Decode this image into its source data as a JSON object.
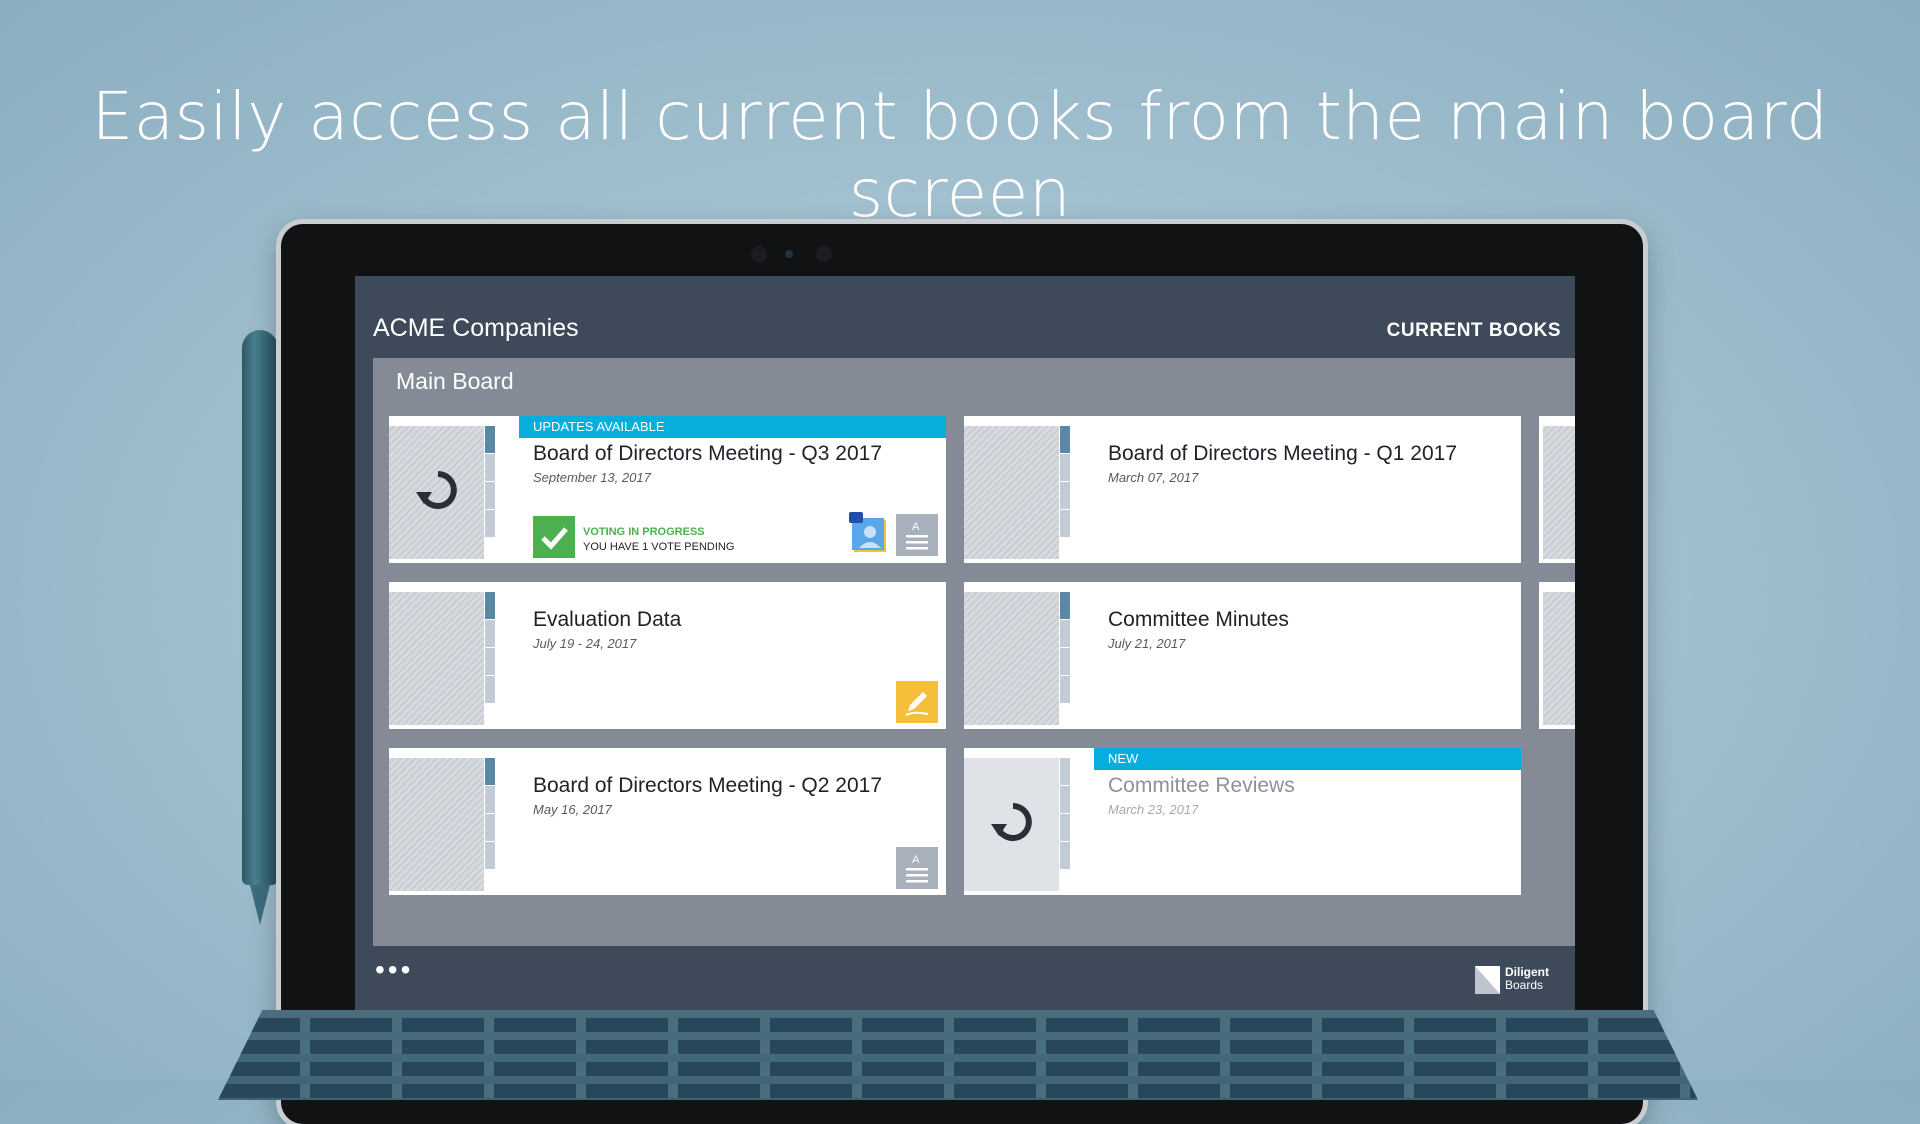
{
  "headline": "Easily access all current books from the main board screen",
  "app": {
    "title": "ACME Companies",
    "section": "CURRENT BOOKS",
    "board_name": "Main Board",
    "more_label": "•••",
    "logo": {
      "line1": "Diligent",
      "line2": "Boards"
    }
  },
  "books": [
    {
      "title": "Board of Directors Meeting - Q3 2017",
      "date": "September 13, 2017",
      "banner": "UPDATES AVAILABLE",
      "status": {
        "label": "VOTING IN PROGRESS",
        "detail": "YOU HAVE 1 VOTE PENDING"
      }
    },
    {
      "title": "Board of Directors Meeting - Q1 2017",
      "date": "March 07, 2017"
    },
    {
      "title": "Evaluation Data",
      "date": "July 19 - 24, 2017"
    },
    {
      "title": "Committee Minutes",
      "date": "July 21, 2017"
    },
    {
      "title": "Board of Directors Meeting - Q2 2017",
      "date": "May 16, 2017"
    },
    {
      "title": "Committee Reviews",
      "date": "March 23, 2017",
      "banner": "NEW"
    }
  ],
  "colors": {
    "accent_banner": "#06aede",
    "vote_green": "#4cb050",
    "annotation_yellow": "#f5bf3a",
    "screen_bg": "#3e4a59",
    "board_bg": "#858b96"
  }
}
